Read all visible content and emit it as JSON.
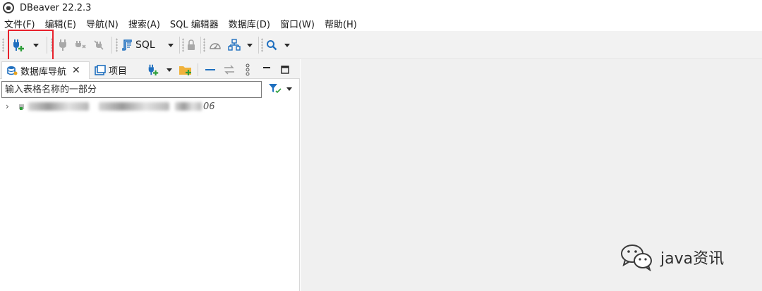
{
  "window": {
    "title": "DBeaver 22.2.3"
  },
  "menu": {
    "items": [
      "文件(F)",
      "编辑(E)",
      "导航(N)",
      "搜索(A)",
      "SQL 编辑器",
      "数据库(D)",
      "窗口(W)",
      "帮助(H)"
    ]
  },
  "toolbar": {
    "sql_label": "SQL",
    "icons": [
      "new-connection-icon",
      "connect-icon",
      "disconnect-icon",
      "invalidate-reconnect-icon",
      "sql-editor-icon",
      "lock-icon",
      "dashboard-icon",
      "erd-icon",
      "search-icon"
    ]
  },
  "navigator": {
    "tabs": [
      {
        "label": "数据库导航",
        "active": true
      },
      {
        "label": "项目",
        "active": false
      }
    ],
    "filter_placeholder": "输入表格名称的一部分",
    "tree": [
      {
        "label_suffix": "06"
      }
    ]
  },
  "watermark": {
    "text": "java资讯"
  },
  "colors": {
    "highlight": "#e8212c",
    "toolbar_bg": "#f2f2f2",
    "right_bg": "#f0f0f0",
    "icon_blue": "#1f6fbf",
    "icon_green": "#2e9e3a"
  }
}
